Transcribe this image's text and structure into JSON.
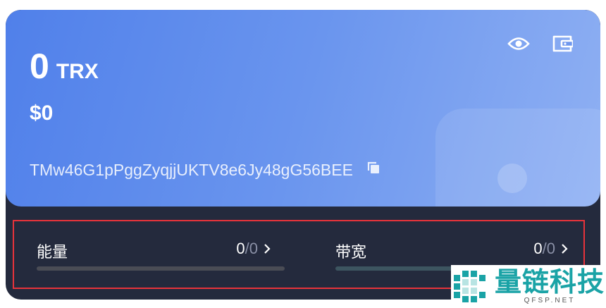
{
  "balance": {
    "amount": "0",
    "unit": "TRX",
    "fiat": "$0"
  },
  "address": "TMw46G1pPggZyqjjUKTV8e6Jy48gG56BEE",
  "icons": [
    "eye-icon",
    "wallet-icon",
    "copy-icon",
    "chevron-right-icon"
  ],
  "resources": {
    "energy": {
      "label": "能量",
      "used": "0",
      "sep": "/",
      "total": "0",
      "fraction": 0
    },
    "bandwidth": {
      "label": "带宽",
      "used": "0",
      "sep": "/",
      "total": "0",
      "fraction": 0
    }
  },
  "watermark": {
    "name": "量链科技",
    "site": "QFSP.NET"
  },
  "colors": {
    "card_start": "#5080ea",
    "card_end": "#8fb0f3",
    "panel": "#242a3d",
    "highlight": "#e8333b",
    "brand": "#1aa3a6"
  }
}
